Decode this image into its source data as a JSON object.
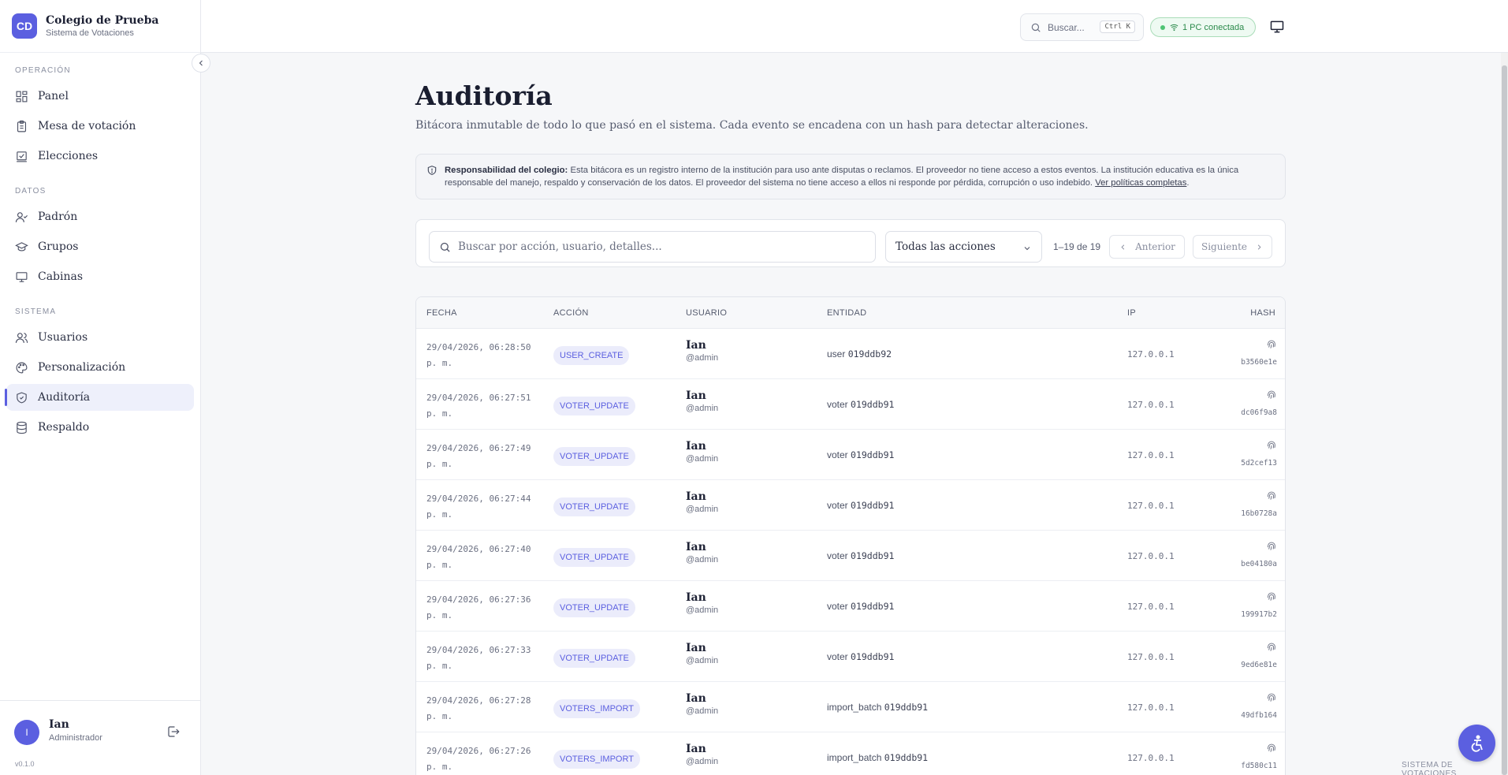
{
  "brand": {
    "initials": "CD",
    "title": "Colegio de Prueba",
    "subtitle": "Sistema de Votaciones"
  },
  "sidebar": {
    "sections": [
      {
        "label": "OPERACIÓN",
        "items": [
          {
            "label": "Panel",
            "icon": "dashboard-icon"
          },
          {
            "label": "Mesa de votación",
            "icon": "clipboard-icon"
          },
          {
            "label": "Elecciones",
            "icon": "ballot-icon"
          }
        ]
      },
      {
        "label": "DATOS",
        "items": [
          {
            "label": "Padrón",
            "icon": "user-check-icon"
          },
          {
            "label": "Grupos",
            "icon": "graduation-cap-icon"
          },
          {
            "label": "Cabinas",
            "icon": "monitor-icon"
          }
        ]
      },
      {
        "label": "SISTEMA",
        "items": [
          {
            "label": "Usuarios",
            "icon": "users-icon"
          },
          {
            "label": "Personalización",
            "icon": "palette-icon"
          },
          {
            "label": "Auditoría",
            "icon": "shield-check-icon",
            "active": true
          },
          {
            "label": "Respaldo",
            "icon": "database-icon"
          }
        ]
      }
    ],
    "user": {
      "initial": "I",
      "name": "Ian",
      "role": "Administrador"
    },
    "version": "v0.1.0"
  },
  "topbar": {
    "search_placeholder": "Buscar...",
    "shortcut": "Ctrl K",
    "connection": "1 PC conectada"
  },
  "page": {
    "title": "Auditoría",
    "subtitle": "Bitácora inmutable de todo lo que pasó en el sistema. Cada evento se encadena con un hash para detectar alteraciones.",
    "notice": {
      "bold": "Responsabilidad del colegio:",
      "text": " Esta bitácora es un registro interno de la institución para uso ante disputas o reclamos. El proveedor no tiene acceso a estos eventos. La institución educativa es la única responsable del manejo, respaldo y conservación de los datos. El proveedor del sistema no tiene acceso a ellos ni responde por pérdida, corrupción o uso indebido. ",
      "link": "Ver políticas completas",
      "after": "."
    }
  },
  "filters": {
    "search_placeholder": "Buscar por acción, usuario, detalles...",
    "action_select": "Todas las acciones",
    "range": "1–19 de 19",
    "prev": "Anterior",
    "next": "Siguiente"
  },
  "table": {
    "columns": {
      "date": "FECHA",
      "action": "ACCIÓN",
      "user": "USUARIO",
      "entity": "ENTIDAD",
      "ip": "IP",
      "hash": "HASH"
    },
    "rows": [
      {
        "date": "29/04/2026, 06:28:50",
        "ampm": "p. m.",
        "action": "USER_CREATE",
        "user": "Ian",
        "handle": "@admin",
        "entity_type": "user",
        "entity_id": "019ddb92",
        "ip": "127.0.0.1",
        "hash": "b3560e1e"
      },
      {
        "date": "29/04/2026, 06:27:51",
        "ampm": "p. m.",
        "action": "VOTER_UPDATE",
        "user": "Ian",
        "handle": "@admin",
        "entity_type": "voter",
        "entity_id": "019ddb91",
        "ip": "127.0.0.1",
        "hash": "dc06f9a8"
      },
      {
        "date": "29/04/2026, 06:27:49",
        "ampm": "p. m.",
        "action": "VOTER_UPDATE",
        "user": "Ian",
        "handle": "@admin",
        "entity_type": "voter",
        "entity_id": "019ddb91",
        "ip": "127.0.0.1",
        "hash": "5d2cef13"
      },
      {
        "date": "29/04/2026, 06:27:44",
        "ampm": "p. m.",
        "action": "VOTER_UPDATE",
        "user": "Ian",
        "handle": "@admin",
        "entity_type": "voter",
        "entity_id": "019ddb91",
        "ip": "127.0.0.1",
        "hash": "16b0728a"
      },
      {
        "date": "29/04/2026, 06:27:40",
        "ampm": "p. m.",
        "action": "VOTER_UPDATE",
        "user": "Ian",
        "handle": "@admin",
        "entity_type": "voter",
        "entity_id": "019ddb91",
        "ip": "127.0.0.1",
        "hash": "be04180a"
      },
      {
        "date": "29/04/2026, 06:27:36",
        "ampm": "p. m.",
        "action": "VOTER_UPDATE",
        "user": "Ian",
        "handle": "@admin",
        "entity_type": "voter",
        "entity_id": "019ddb91",
        "ip": "127.0.0.1",
        "hash": "199917b2"
      },
      {
        "date": "29/04/2026, 06:27:33",
        "ampm": "p. m.",
        "action": "VOTER_UPDATE",
        "user": "Ian",
        "handle": "@admin",
        "entity_type": "voter",
        "entity_id": "019ddb91",
        "ip": "127.0.0.1",
        "hash": "9ed6e81e"
      },
      {
        "date": "29/04/2026, 06:27:28",
        "ampm": "p. m.",
        "action": "VOTERS_IMPORT",
        "user": "Ian",
        "handle": "@admin",
        "entity_type": "import_batch",
        "entity_id": "019ddb91",
        "ip": "127.0.0.1",
        "hash": "49dfb164"
      },
      {
        "date": "29/04/2026, 06:27:26",
        "ampm": "p. m.",
        "action": "VOTERS_IMPORT",
        "user": "Ian",
        "handle": "@admin",
        "entity_type": "import_batch",
        "entity_id": "019ddb91",
        "ip": "127.0.0.1",
        "hash": "fd580c11"
      }
    ]
  },
  "footer_tag": "SISTEMA DE VOTACIONES",
  "colors": {
    "accent": "#5b5fe0",
    "success": "#2b8a4b",
    "badge_bg": "#ebecfb"
  }
}
